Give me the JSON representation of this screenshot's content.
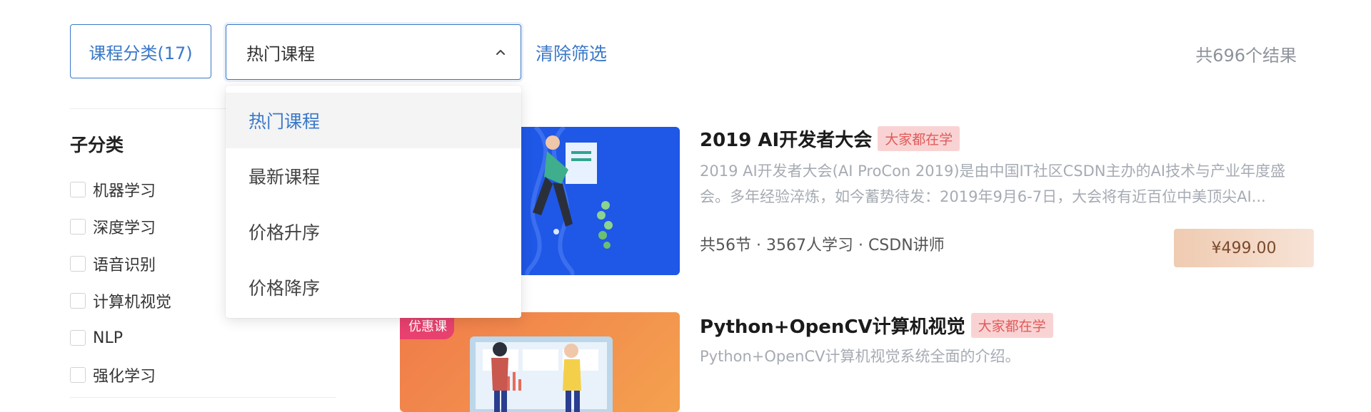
{
  "toolbar": {
    "category_button": "课程分类(17)",
    "sort_selected": "热门课程",
    "clear_filter": "清除筛选",
    "result_count": "共696个结果"
  },
  "sort_dropdown": {
    "options": [
      "热门课程",
      "最新课程",
      "价格升序",
      "价格降序"
    ],
    "active_index": 0
  },
  "sidebar": {
    "title": "子分类",
    "items": [
      "机器学习",
      "深度学习",
      "语音识别",
      "计算机视觉",
      "NLP",
      "强化学习"
    ]
  },
  "courses": [
    {
      "title": "2019 AI开发者大会",
      "badge": "大家都在学",
      "desc_line1": "2019 AI开发者大会(AI ProCon 2019)是由中国IT社区CSDN主办的AI技术与产业年度盛",
      "desc_line2": "会。多年经验淬炼，如今蓄势待发：2019年9月6-7日，大会将有近百位中美顶尖AI...",
      "meta": "共56节 · 3567人学习 · CSDN讲师",
      "price": "¥499.00"
    },
    {
      "title": "Python+OpenCV计算机视觉",
      "badge": "大家都在学",
      "promo_tag": "优惠课",
      "desc_line1": "Python+OpenCV计算机视觉系统全面的介绍。"
    }
  ],
  "colors": {
    "accent": "#3a78c8",
    "badge_bg": "#f9d3d3",
    "badge_text": "#e15a5a",
    "thumb1_bg": "#1f57e6",
    "promo_tag": "#e8416f"
  }
}
